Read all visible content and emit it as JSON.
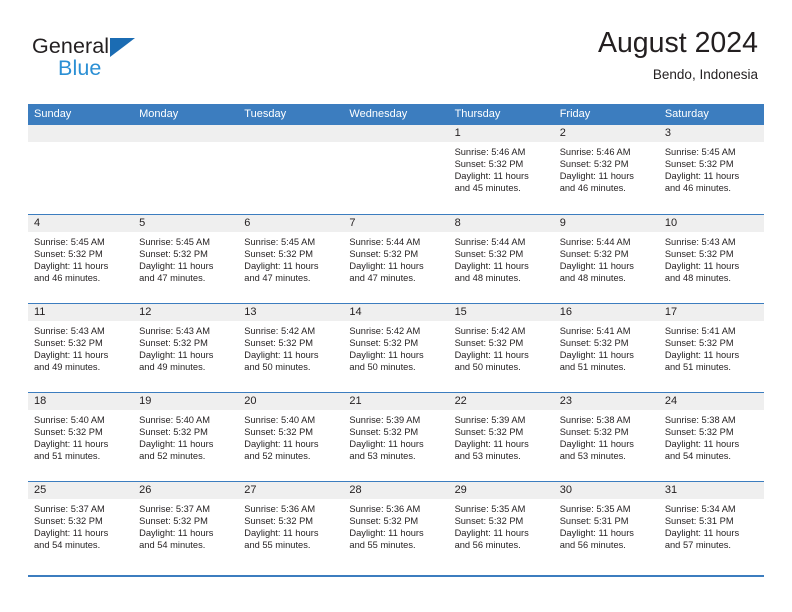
{
  "brand": {
    "name_dark": "General",
    "name_blue": "Blue",
    "accent_blue": "#2b8fd4",
    "triangle_blue": "#1b6cb3"
  },
  "header": {
    "title": "August 2024",
    "subtitle": "Bendo, Indonesia"
  },
  "calendar": {
    "header_color": "#3c7dbf",
    "date_band_color": "#efefef",
    "weekdays": [
      "Sunday",
      "Monday",
      "Tuesday",
      "Wednesday",
      "Thursday",
      "Friday",
      "Saturday"
    ],
    "weeks": [
      [
        {
          "day": "",
          "lines": []
        },
        {
          "day": "",
          "lines": []
        },
        {
          "day": "",
          "lines": []
        },
        {
          "day": "",
          "lines": []
        },
        {
          "day": "1",
          "lines": [
            "Sunrise: 5:46 AM",
            "Sunset: 5:32 PM",
            "Daylight: 11 hours",
            "and 45 minutes."
          ]
        },
        {
          "day": "2",
          "lines": [
            "Sunrise: 5:46 AM",
            "Sunset: 5:32 PM",
            "Daylight: 11 hours",
            "and 46 minutes."
          ]
        },
        {
          "day": "3",
          "lines": [
            "Sunrise: 5:45 AM",
            "Sunset: 5:32 PM",
            "Daylight: 11 hours",
            "and 46 minutes."
          ]
        }
      ],
      [
        {
          "day": "4",
          "lines": [
            "Sunrise: 5:45 AM",
            "Sunset: 5:32 PM",
            "Daylight: 11 hours",
            "and 46 minutes."
          ]
        },
        {
          "day": "5",
          "lines": [
            "Sunrise: 5:45 AM",
            "Sunset: 5:32 PM",
            "Daylight: 11 hours",
            "and 47 minutes."
          ]
        },
        {
          "day": "6",
          "lines": [
            "Sunrise: 5:45 AM",
            "Sunset: 5:32 PM",
            "Daylight: 11 hours",
            "and 47 minutes."
          ]
        },
        {
          "day": "7",
          "lines": [
            "Sunrise: 5:44 AM",
            "Sunset: 5:32 PM",
            "Daylight: 11 hours",
            "and 47 minutes."
          ]
        },
        {
          "day": "8",
          "lines": [
            "Sunrise: 5:44 AM",
            "Sunset: 5:32 PM",
            "Daylight: 11 hours",
            "and 48 minutes."
          ]
        },
        {
          "day": "9",
          "lines": [
            "Sunrise: 5:44 AM",
            "Sunset: 5:32 PM",
            "Daylight: 11 hours",
            "and 48 minutes."
          ]
        },
        {
          "day": "10",
          "lines": [
            "Sunrise: 5:43 AM",
            "Sunset: 5:32 PM",
            "Daylight: 11 hours",
            "and 48 minutes."
          ]
        }
      ],
      [
        {
          "day": "11",
          "lines": [
            "Sunrise: 5:43 AM",
            "Sunset: 5:32 PM",
            "Daylight: 11 hours",
            "and 49 minutes."
          ]
        },
        {
          "day": "12",
          "lines": [
            "Sunrise: 5:43 AM",
            "Sunset: 5:32 PM",
            "Daylight: 11 hours",
            "and 49 minutes."
          ]
        },
        {
          "day": "13",
          "lines": [
            "Sunrise: 5:42 AM",
            "Sunset: 5:32 PM",
            "Daylight: 11 hours",
            "and 50 minutes."
          ]
        },
        {
          "day": "14",
          "lines": [
            "Sunrise: 5:42 AM",
            "Sunset: 5:32 PM",
            "Daylight: 11 hours",
            "and 50 minutes."
          ]
        },
        {
          "day": "15",
          "lines": [
            "Sunrise: 5:42 AM",
            "Sunset: 5:32 PM",
            "Daylight: 11 hours",
            "and 50 minutes."
          ]
        },
        {
          "day": "16",
          "lines": [
            "Sunrise: 5:41 AM",
            "Sunset: 5:32 PM",
            "Daylight: 11 hours",
            "and 51 minutes."
          ]
        },
        {
          "day": "17",
          "lines": [
            "Sunrise: 5:41 AM",
            "Sunset: 5:32 PM",
            "Daylight: 11 hours",
            "and 51 minutes."
          ]
        }
      ],
      [
        {
          "day": "18",
          "lines": [
            "Sunrise: 5:40 AM",
            "Sunset: 5:32 PM",
            "Daylight: 11 hours",
            "and 51 minutes."
          ]
        },
        {
          "day": "19",
          "lines": [
            "Sunrise: 5:40 AM",
            "Sunset: 5:32 PM",
            "Daylight: 11 hours",
            "and 52 minutes."
          ]
        },
        {
          "day": "20",
          "lines": [
            "Sunrise: 5:40 AM",
            "Sunset: 5:32 PM",
            "Daylight: 11 hours",
            "and 52 minutes."
          ]
        },
        {
          "day": "21",
          "lines": [
            "Sunrise: 5:39 AM",
            "Sunset: 5:32 PM",
            "Daylight: 11 hours",
            "and 53 minutes."
          ]
        },
        {
          "day": "22",
          "lines": [
            "Sunrise: 5:39 AM",
            "Sunset: 5:32 PM",
            "Daylight: 11 hours",
            "and 53 minutes."
          ]
        },
        {
          "day": "23",
          "lines": [
            "Sunrise: 5:38 AM",
            "Sunset: 5:32 PM",
            "Daylight: 11 hours",
            "and 53 minutes."
          ]
        },
        {
          "day": "24",
          "lines": [
            "Sunrise: 5:38 AM",
            "Sunset: 5:32 PM",
            "Daylight: 11 hours",
            "and 54 minutes."
          ]
        }
      ],
      [
        {
          "day": "25",
          "lines": [
            "Sunrise: 5:37 AM",
            "Sunset: 5:32 PM",
            "Daylight: 11 hours",
            "and 54 minutes."
          ]
        },
        {
          "day": "26",
          "lines": [
            "Sunrise: 5:37 AM",
            "Sunset: 5:32 PM",
            "Daylight: 11 hours",
            "and 54 minutes."
          ]
        },
        {
          "day": "27",
          "lines": [
            "Sunrise: 5:36 AM",
            "Sunset: 5:32 PM",
            "Daylight: 11 hours",
            "and 55 minutes."
          ]
        },
        {
          "day": "28",
          "lines": [
            "Sunrise: 5:36 AM",
            "Sunset: 5:32 PM",
            "Daylight: 11 hours",
            "and 55 minutes."
          ]
        },
        {
          "day": "29",
          "lines": [
            "Sunrise: 5:35 AM",
            "Sunset: 5:32 PM",
            "Daylight: 11 hours",
            "and 56 minutes."
          ]
        },
        {
          "day": "30",
          "lines": [
            "Sunrise: 5:35 AM",
            "Sunset: 5:31 PM",
            "Daylight: 11 hours",
            "and 56 minutes."
          ]
        },
        {
          "day": "31",
          "lines": [
            "Sunrise: 5:34 AM",
            "Sunset: 5:31 PM",
            "Daylight: 11 hours",
            "and 57 minutes."
          ]
        }
      ]
    ]
  }
}
